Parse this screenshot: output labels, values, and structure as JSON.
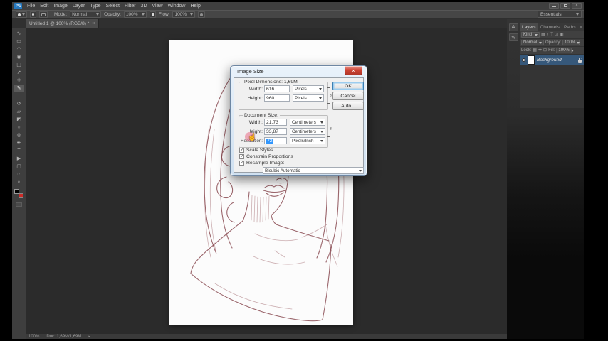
{
  "app": {
    "logo": "Ps"
  },
  "icons": {
    "close": "×",
    "menu": "≡",
    "check": "✓",
    "link": "∞",
    "arrow": "▸"
  },
  "menu": {
    "items": [
      "File",
      "Edit",
      "Image",
      "Layer",
      "Type",
      "Select",
      "Filter",
      "3D",
      "View",
      "Window",
      "Help"
    ]
  },
  "options_bar": {
    "mode_label": "Mode:",
    "mode_value": "Normal",
    "opacity_label": "Opacity:",
    "opacity_value": "100%",
    "flow_label": "Flow:",
    "flow_value": "100%"
  },
  "workspace": {
    "label": "Essentials"
  },
  "document_tab": {
    "title": "Untitled 1 @ 100% (RGB/8) *"
  },
  "toolbar": {
    "tools": [
      {
        "name": "move",
        "glyph": "⇖"
      },
      {
        "name": "rectangular-marquee",
        "glyph": "▭"
      },
      {
        "name": "lasso",
        "glyph": "◠"
      },
      {
        "name": "quick-selection",
        "glyph": "◉"
      },
      {
        "name": "crop",
        "glyph": "◱"
      },
      {
        "name": "eyedropper",
        "glyph": "↗"
      },
      {
        "name": "healing-brush",
        "glyph": "✚"
      },
      {
        "name": "brush",
        "glyph": "✎"
      },
      {
        "name": "clone-stamp",
        "glyph": "⊥"
      },
      {
        "name": "history-brush",
        "glyph": "↺"
      },
      {
        "name": "eraser",
        "glyph": "▱"
      },
      {
        "name": "gradient",
        "glyph": "◩"
      },
      {
        "name": "blur",
        "glyph": "○"
      },
      {
        "name": "dodge",
        "glyph": "◎"
      },
      {
        "name": "pen",
        "glyph": "✒"
      },
      {
        "name": "type",
        "glyph": "T"
      },
      {
        "name": "path-selection",
        "glyph": "▶"
      },
      {
        "name": "rectangle",
        "glyph": "▢"
      },
      {
        "name": "hand",
        "glyph": "☞"
      },
      {
        "name": "zoom",
        "glyph": "⌕"
      }
    ]
  },
  "dialog": {
    "title": "Image Size",
    "pixel_dimensions": {
      "heading": "Pixel Dimensions: 1,69M",
      "width_label": "Width:",
      "width_value": "616",
      "width_unit": "Pixels",
      "height_label": "Height:",
      "height_value": "960",
      "height_unit": "Pixels"
    },
    "document_size": {
      "heading": "Document Size:",
      "width_label": "Width:",
      "width_value": "21,73",
      "width_unit": "Centimeters",
      "height_label": "Height:",
      "height_value": "33,87",
      "height_unit": "Centimeters",
      "resolution_label": "Resolution:",
      "resolution_value": "72",
      "resolution_unit": "Pixels/Inch"
    },
    "checkboxes": [
      {
        "label": "Scale Styles",
        "checked": true
      },
      {
        "label": "Constrain Proportions",
        "checked": true
      },
      {
        "label": "Resample Image:",
        "checked": true
      }
    ],
    "resample_method": "Bicubic Automatic",
    "buttons": {
      "ok": "OK",
      "cancel": "Cancel",
      "auto": "Auto..."
    }
  },
  "dock_strip": {
    "icons": [
      {
        "name": "character-panel-icon",
        "glyph": "A"
      },
      {
        "name": "brush-presets-icon",
        "glyph": "✎"
      }
    ]
  },
  "layers_panel": {
    "tabs": [
      "Layers",
      "Channels",
      "Paths"
    ],
    "kind_label": "Kind",
    "filter_icons": [
      "▦",
      "◐",
      "T",
      "⊡",
      "▣"
    ],
    "blend_mode": "Normal",
    "opacity_label": "Opacity:",
    "opacity_value": "100%",
    "lock_label": "Lock:",
    "lock_icons": [
      "▦",
      "✚",
      "⊡"
    ],
    "fill_label": "Fill:",
    "fill_value": "100%",
    "layer": {
      "name": "Background",
      "locked": true,
      "visible": true
    }
  },
  "status_bar": {
    "zoom": "100%",
    "doc_info": "Doc: 1,69M/1,69M"
  },
  "colors": {
    "accent_blue": "#3297fd",
    "sketch_line": "#8a4b52",
    "layer_selected_bg": "#36587a",
    "foreground_swatch": "#000000",
    "background_swatch": "#cb2b27"
  }
}
